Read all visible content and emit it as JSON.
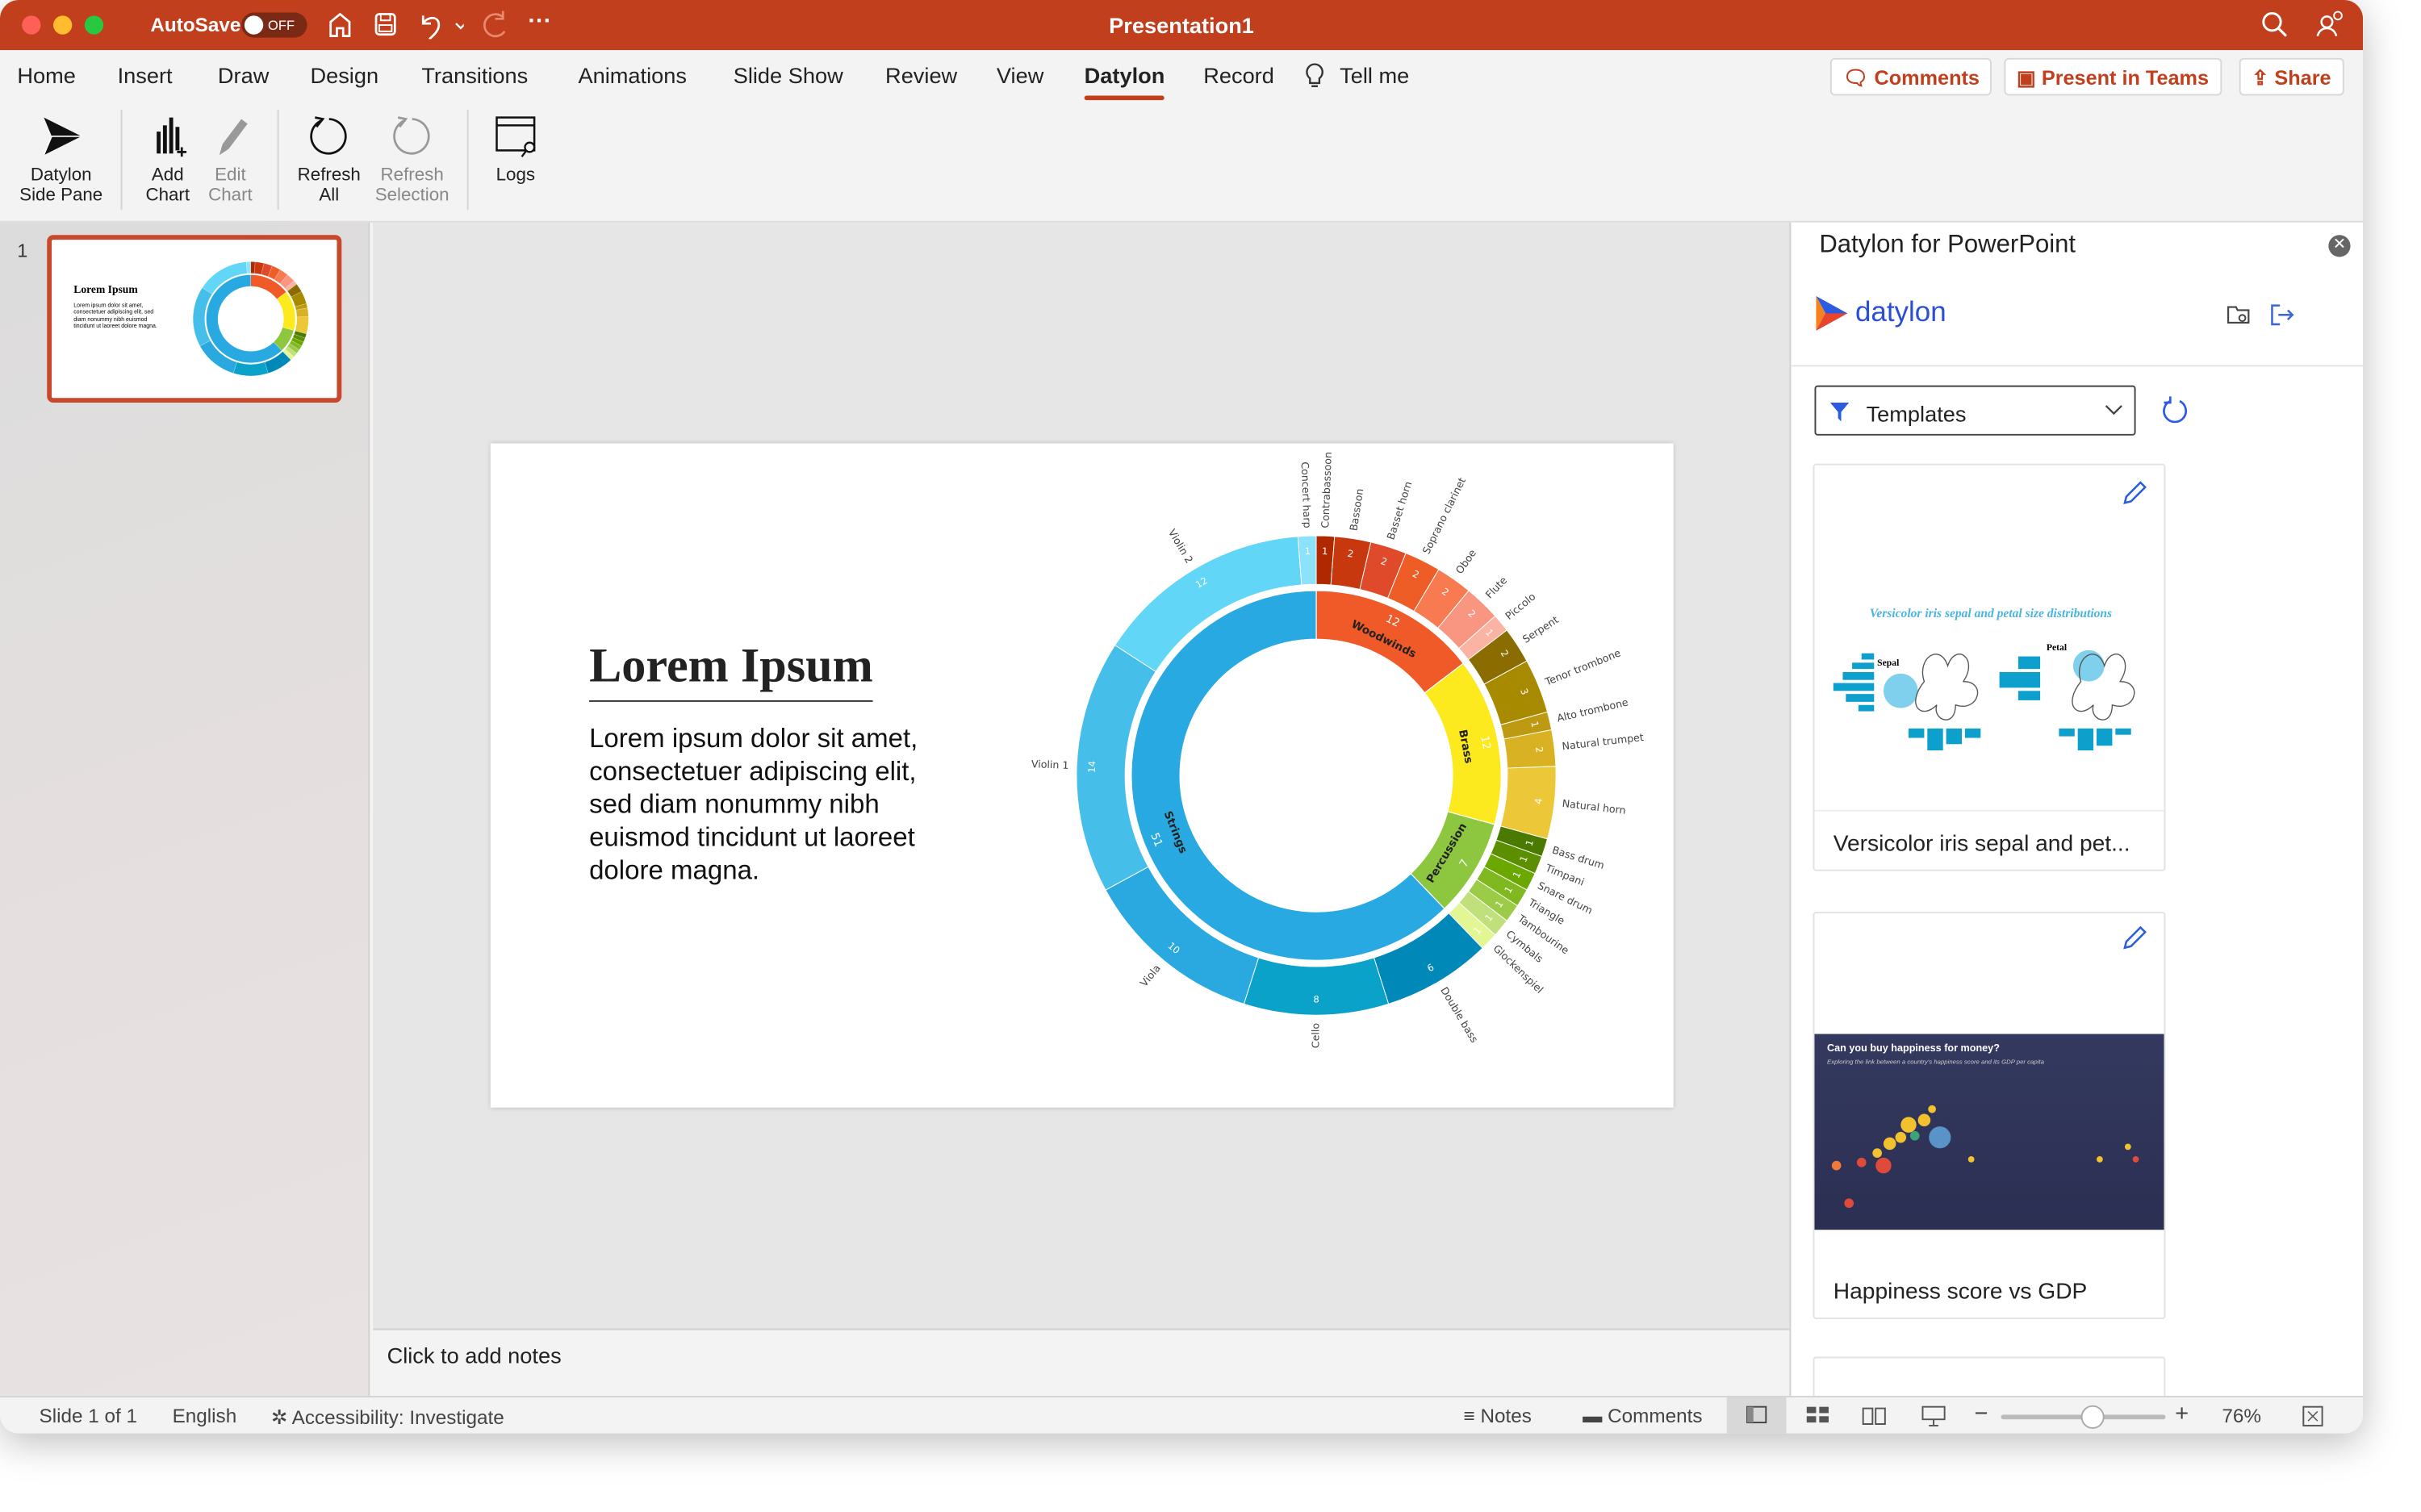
{
  "titlebar": {
    "autosave_label": "AutoSave",
    "autosave_state": "OFF",
    "title": "Presentation1"
  },
  "tabs": [
    "Home",
    "Insert",
    "Draw",
    "Design",
    "Transitions",
    "Animations",
    "Slide Show",
    "Review",
    "View",
    "Datylon",
    "Record"
  ],
  "active_tab": "Datylon",
  "tell_me": "Tell me",
  "top_buttons": {
    "comments": "Comments",
    "present": "Present in Teams",
    "share": "Share"
  },
  "ribbon": {
    "side_pane": [
      "Datylon",
      "Side Pane"
    ],
    "add_chart": [
      "Add",
      "Chart"
    ],
    "edit_chart": [
      "Edit",
      "Chart"
    ],
    "refresh_all": [
      "Refresh",
      "All"
    ],
    "refresh_selection": [
      "Refresh",
      "Selection"
    ],
    "logs": "Logs"
  },
  "thumbnail": {
    "number": "1"
  },
  "slide": {
    "title": "Lorem Ipsum",
    "body": "Lorem ipsum dolor sit amet, consectetuer adipiscing elit, sed diam nonummy nibh euismod tincidunt ut laoreet dolore magna."
  },
  "notes_placeholder": "Click to add notes",
  "pane": {
    "title": "Datylon for PowerPoint",
    "brand": "datylon",
    "filter_label": "Templates",
    "templates": [
      {
        "name": "Versicolor iris sepal and pet...",
        "preview_title": "Versicolor iris sepal and petal size distributions",
        "preview_labels": [
          "Sepal",
          "Petal"
        ]
      },
      {
        "name": "Happiness score vs GDP",
        "preview_title": "Can you buy happiness for money?",
        "preview_subtitle": "Exploring the link between a country's happiness score and its GDP per capita"
      }
    ]
  },
  "status": {
    "slide": "Slide 1 of 1",
    "language": "English",
    "accessibility": "Accessibility: Investigate",
    "notes": "Notes",
    "comments": "Comments",
    "zoom": "76%",
    "zoom_fraction": 0.55
  },
  "chart_data": {
    "type": "sunburst",
    "title": "",
    "total": 82,
    "groups": [
      {
        "name": "Woodwinds",
        "value": 12,
        "color": "#f05a28",
        "children": [
          {
            "name": "Contrabassoon",
            "value": 1,
            "color": "#b02800"
          },
          {
            "name": "Bassoon",
            "value": 2,
            "color": "#c8380f"
          },
          {
            "name": "Basset horn",
            "value": 2,
            "color": "#df4a2a"
          },
          {
            "name": "Soprano clarinet",
            "value": 2,
            "color": "#ef5d26"
          },
          {
            "name": "Oboe",
            "value": 2,
            "color": "#f77a50"
          },
          {
            "name": "Flute",
            "value": 2,
            "color": "#f99682"
          },
          {
            "name": "Piccolo",
            "value": 1,
            "color": "#fbb3a3"
          }
        ]
      },
      {
        "name": "Brass",
        "value": 12,
        "color": "#fce91e",
        "children": [
          {
            "name": "Serpent",
            "value": 2,
            "color": "#8a6c00"
          },
          {
            "name": "Tenor trombone",
            "value": 3,
            "color": "#a88a00"
          },
          {
            "name": "Alto trombone",
            "value": 1,
            "color": "#be9a12"
          },
          {
            "name": "Natural trumpet",
            "value": 2,
            "color": "#d9b224"
          },
          {
            "name": "Natural horn",
            "value": 4,
            "color": "#ecc838"
          }
        ]
      },
      {
        "name": "Percussion",
        "value": 7,
        "color": "#8dc63f",
        "children": [
          {
            "name": "Bass drum",
            "value": 1,
            "color": "#4a7a00"
          },
          {
            "name": "Timpani",
            "value": 1,
            "color": "#5b8f00"
          },
          {
            "name": "Snare drum",
            "value": 1,
            "color": "#6aa800"
          },
          {
            "name": "Triangle",
            "value": 1,
            "color": "#80b820"
          },
          {
            "name": "Tambourine",
            "value": 1,
            "color": "#9ccb48"
          },
          {
            "name": "Cymbals",
            "value": 1,
            "color": "#bfe07a"
          },
          {
            "name": "Glockenspiel",
            "value": 1,
            "color": "#e2f794"
          }
        ]
      },
      {
        "name": "Strings",
        "value": 51,
        "color": "#29a9e1",
        "children": [
          {
            "name": "Double bass",
            "value": 6,
            "color": "#0088b8"
          },
          {
            "name": "Cello",
            "value": 8,
            "color": "#0aa2c9"
          },
          {
            "name": "Viola",
            "value": 10,
            "color": "#2aa9e1"
          },
          {
            "name": "Violin 1",
            "value": 14,
            "color": "#45bfe9"
          },
          {
            "name": "Violin 2",
            "value": 12,
            "color": "#62d6f7"
          },
          {
            "name": "Concert harp",
            "value": 1,
            "color": "#8de2fb"
          }
        ]
      }
    ]
  }
}
